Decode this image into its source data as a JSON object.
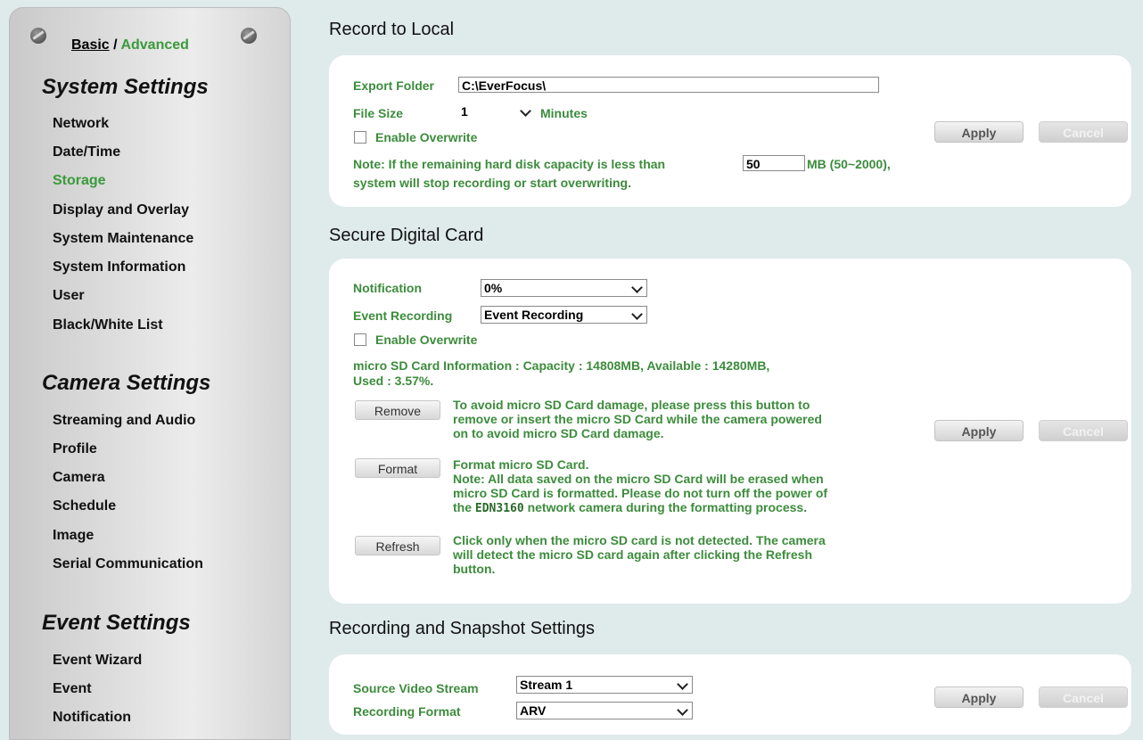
{
  "sidebar": {
    "mode": {
      "basic": "Basic",
      "separator": " / ",
      "advanced": "Advanced"
    },
    "system_title": "System Settings",
    "system_items": [
      "Network",
      "Date/Time",
      "Storage",
      "Display and Overlay",
      "System Maintenance",
      "System Information",
      "User",
      "Black/White List"
    ],
    "camera_title": "Camera Settings",
    "camera_items": [
      "Streaming and Audio",
      "Profile",
      "Camera",
      "Schedule",
      "Image",
      "Serial Communication"
    ],
    "event_title": "Event Settings",
    "event_items": [
      "Event Wizard",
      "Event",
      "Notification"
    ],
    "active_item": "Storage"
  },
  "record_local": {
    "title": "Record to Local",
    "export_label": "Export Folder",
    "export_value": "C:\\EverFocus\\",
    "filesize_label": "File Size",
    "filesize_value": "1",
    "filesize_unit": "Minutes",
    "overwrite_label": "Enable Overwrite",
    "note_prefix": "Note: If the remaining hard disk capacity is less than",
    "capacity_value": "50",
    "note_suffix": "MB (50~2000),",
    "note_line2": "system will stop recording or start overwriting.",
    "apply": "Apply",
    "cancel": "Cancel"
  },
  "sd_card": {
    "title": "Secure Digital Card",
    "notification_label": "Notification",
    "notification_value": "0%",
    "event_rec_label": "Event Recording",
    "event_rec_value": "Event Recording",
    "overwrite_label": "Enable Overwrite",
    "info_line1": "micro SD Card Information : Capacity : 14808MB, Available : 14280MB,",
    "info_line2": "Used : 3.57%.",
    "remove_btn": "Remove",
    "remove_desc": [
      "To avoid micro SD Card damage, please press this button to",
      "remove or insert the micro SD Card while the camera powered",
      "on to avoid micro SD Card damage."
    ],
    "format_btn": "Format",
    "format_desc": [
      "Format micro SD Card.",
      "Note: All data saved on the micro SD Card will be erased when",
      "micro SD Card is formatted. Please do not turn off the power of"
    ],
    "format_desc_last_prefix": "the",
    "model": "EDN3160",
    "format_desc_last_suffix": "network camera during the formatting process.",
    "refresh_btn": "Refresh",
    "refresh_desc": [
      "Click only when the micro SD card is not detected. The camera",
      "will detect the micro SD card again after clicking the Refresh",
      "button."
    ],
    "apply": "Apply",
    "cancel": "Cancel"
  },
  "rec_snapshot": {
    "title": "Recording and Snapshot Settings",
    "source_label": "Source Video Stream",
    "source_value": "Stream 1",
    "format_label": "Recording Format",
    "format_value": "ARV",
    "apply": "Apply",
    "cancel": "Cancel"
  }
}
